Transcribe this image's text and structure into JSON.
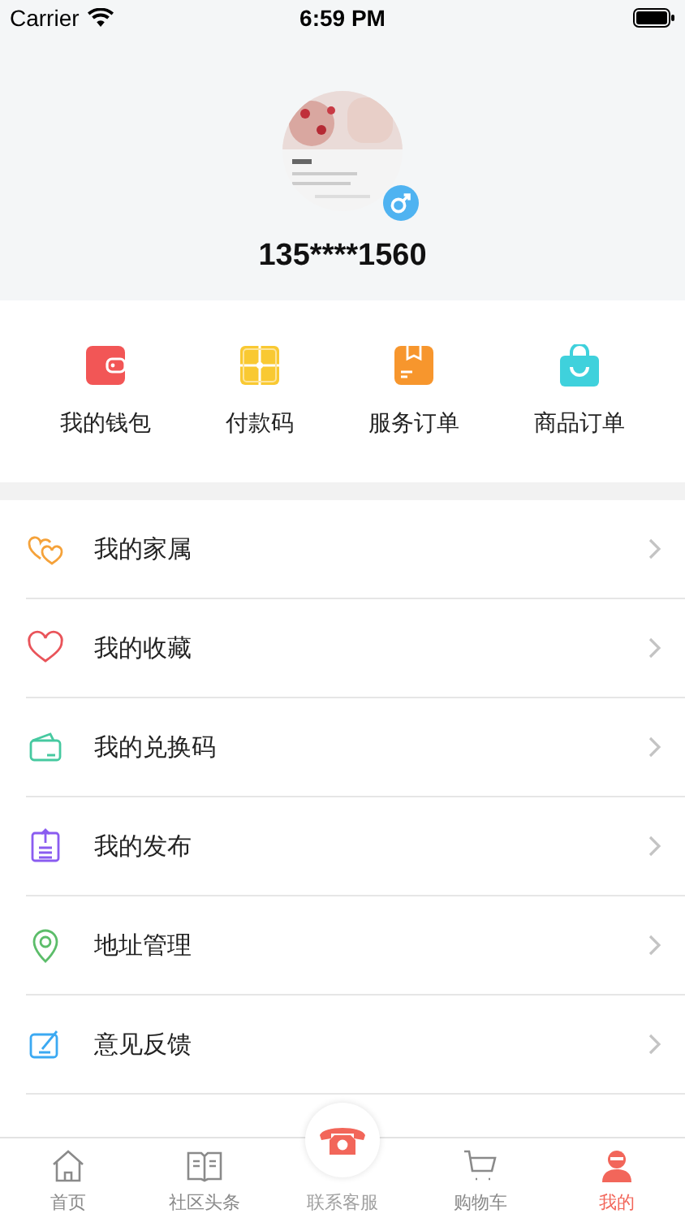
{
  "status_bar": {
    "carrier": "Carrier",
    "time": "6:59 PM"
  },
  "profile": {
    "phone": "135****1560"
  },
  "shortcuts": [
    {
      "label": "我的钱包"
    },
    {
      "label": "付款码"
    },
    {
      "label": "服务订单"
    },
    {
      "label": "商品订单"
    }
  ],
  "menu": [
    {
      "label": "我的家属"
    },
    {
      "label": "我的收藏"
    },
    {
      "label": "我的兑换码"
    },
    {
      "label": "我的发布"
    },
    {
      "label": "地址管理"
    },
    {
      "label": "意见反馈"
    }
  ],
  "tab_bar": [
    {
      "label": "首页",
      "kind": "normal",
      "selected": false
    },
    {
      "label": "社区头条",
      "kind": "normal",
      "selected": false
    },
    {
      "label": "联系客服",
      "kind": "raised",
      "selected": false
    },
    {
      "label": "购物车",
      "kind": "normal",
      "selected": false
    },
    {
      "label": "我的",
      "kind": "normal",
      "selected": true
    }
  ]
}
